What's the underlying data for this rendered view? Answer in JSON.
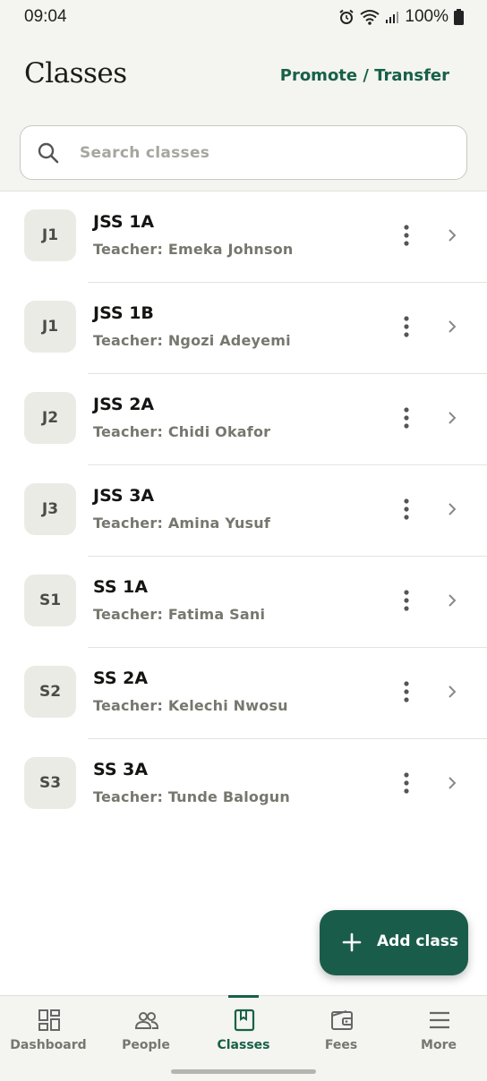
{
  "status_bar": {
    "time": "09:04",
    "battery": "100%"
  },
  "header": {
    "title": "Classes",
    "promote_label": "Promote / Transfer"
  },
  "search": {
    "placeholder": "Search classes"
  },
  "classes": [
    {
      "code": "J1",
      "name": "JSS 1A",
      "teacher": "Teacher: Emeka Johnson"
    },
    {
      "code": "J1",
      "name": "JSS 1B",
      "teacher": "Teacher: Ngozi Adeyemi"
    },
    {
      "code": "J2",
      "name": "JSS 2A",
      "teacher": "Teacher: Chidi Okafor"
    },
    {
      "code": "J3",
      "name": "JSS 3A",
      "teacher": "Teacher: Amina Yusuf"
    },
    {
      "code": "S1",
      "name": "SS 1A",
      "teacher": "Teacher: Fatima Sani"
    },
    {
      "code": "S2",
      "name": "SS 2A",
      "teacher": "Teacher: Kelechi Nwosu"
    },
    {
      "code": "S3",
      "name": "SS 3A",
      "teacher": "Teacher: Tunde Balogun"
    }
  ],
  "fab": {
    "label": "Add class"
  },
  "bottom_nav": {
    "items": [
      {
        "label": "Dashboard",
        "icon": "dashboard-icon"
      },
      {
        "label": "People",
        "icon": "people-icon"
      },
      {
        "label": "Classes",
        "icon": "book-icon",
        "active": true
      },
      {
        "label": "Fees",
        "icon": "wallet-icon"
      },
      {
        "label": "More",
        "icon": "menu-icon"
      }
    ]
  },
  "colors": {
    "accent": "#176148",
    "fab_background": "#1a5c4a",
    "header_background": "#f4f4f0",
    "badge_background": "#ebebe6"
  }
}
